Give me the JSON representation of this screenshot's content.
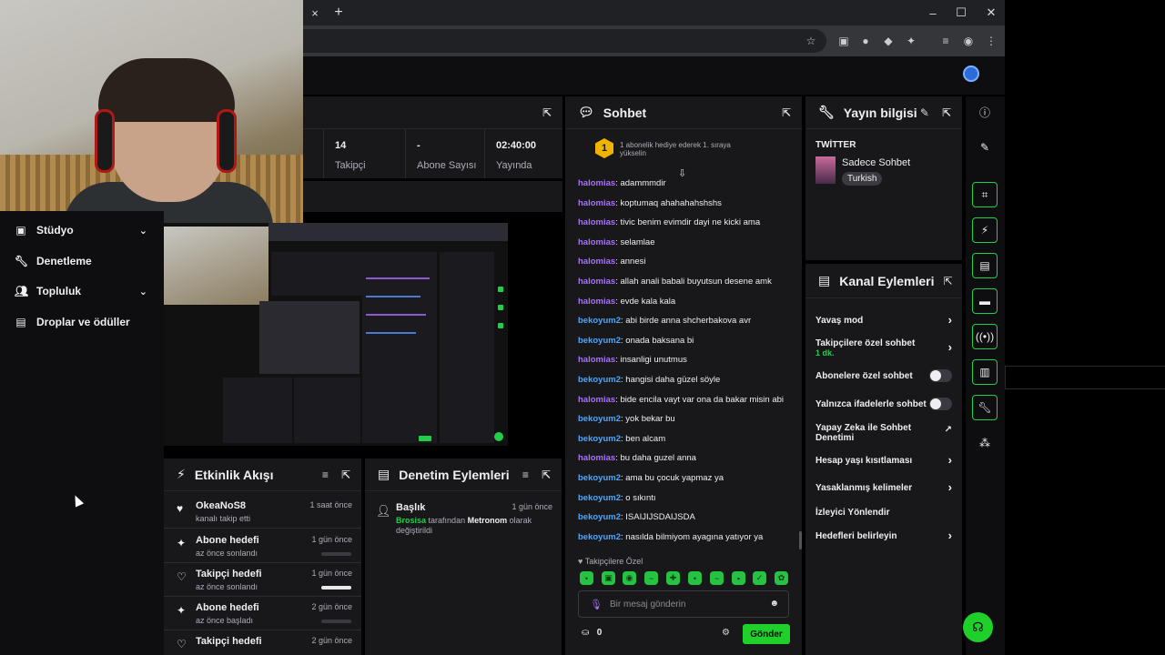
{
  "browser": {
    "tab_close": "×",
    "new_tab": "+",
    "window_controls": [
      "–",
      "☐",
      "✕"
    ]
  },
  "sidebar": {
    "items": [
      {
        "label": "Stüdyo",
        "icon": "studio-icon",
        "expandable": true
      },
      {
        "label": "Denetleme",
        "icon": "wrench-icon",
        "expandable": false
      },
      {
        "label": "Topluluk",
        "icon": "community-icon",
        "expandable": true
      },
      {
        "label": "Droplar ve ödüller",
        "icon": "drops-icon",
        "expandable": false
      }
    ]
  },
  "stats": [
    {
      "value": "14",
      "label": "Takipçi"
    },
    {
      "value": "-",
      "label": "Abone Sayısı"
    },
    {
      "value": "02:40:00",
      "label": "Yayında"
    }
  ],
  "activity_feed": {
    "title": "Etkinlik Akışı",
    "items": [
      {
        "icon": "heart-filled-icon",
        "title": "OkeaNoS8",
        "subtitle": "kanalı takip etti",
        "time": "1 saat önce",
        "progress": null
      },
      {
        "icon": "sparkle-icon",
        "title": "Abone hedefi",
        "subtitle": "az önce sonlandı",
        "time": "1 gün önce",
        "progress": 0
      },
      {
        "icon": "heart-outline-icon",
        "title": "Takipçi hedefi",
        "subtitle": "az önce sonlandı",
        "time": "1 gün önce",
        "progress": 1
      },
      {
        "icon": "sparkle-icon",
        "title": "Abone hedefi",
        "subtitle": "az önce başladı",
        "time": "2 gün önce",
        "progress": 0
      },
      {
        "icon": "heart-outline-icon",
        "title": "Takipçi hedefi",
        "subtitle": "",
        "time": "2 gün önce",
        "progress": null
      }
    ]
  },
  "moderation": {
    "title": "Denetim Eylemleri",
    "item": {
      "title": "Başlık",
      "actor": "Brosisa",
      "mid": "tarafından",
      "target": "Metronom",
      "end": "olarak değiştirildi",
      "time": "1 gün önce"
    }
  },
  "chat": {
    "title": "Sohbet",
    "hype_level": "1",
    "hype_text": "1 abonelik hediye ederek 1. sıraya yükselin",
    "messages": [
      {
        "user": "halomias",
        "text": "adammmdir"
      },
      {
        "user": "halomias",
        "text": "koptumaq ahahahahshshs"
      },
      {
        "user": "halomias",
        "text": "tivic benim evimdir dayi ne kicki ama"
      },
      {
        "user": "halomias",
        "text": "selamlae"
      },
      {
        "user": "halomias",
        "text": "annesi"
      },
      {
        "user": "halomias",
        "text": "allah anali babali buyutsun desene amk"
      },
      {
        "user": "halomias",
        "text": "evde kala kala"
      },
      {
        "user": "bekoyum2",
        "text": "abi birde anna shcherbakova avr"
      },
      {
        "user": "bekoyum2",
        "text": "onada baksana bi"
      },
      {
        "user": "halomias",
        "text": "insanligi unutmus"
      },
      {
        "user": "bekoyum2",
        "text": "hangisi daha güzel söyle"
      },
      {
        "user": "halomias",
        "text": "bide encila vayt var ona da bakar misin abi"
      },
      {
        "user": "bekoyum2",
        "text": "yok bekar bu"
      },
      {
        "user": "bekoyum2",
        "text": "ben alcam"
      },
      {
        "user": "halomias",
        "text": "bu daha guzel anna"
      },
      {
        "user": "bekoyum2",
        "text": "ama bu çocuk yapmaz ya"
      },
      {
        "user": "bekoyum2",
        "text": "o sıkıntı"
      },
      {
        "user": "bekoyum2",
        "text": "ISAIJIJSDAIJSDA"
      },
      {
        "user": "bekoyum2",
        "text": "nasılda bilmiyom ayagına yatıyor ya"
      }
    ],
    "emotes_label": "Takipçilere Özel",
    "input_placeholder": "Bir mesaj gönderin",
    "points": "0",
    "send_label": "Gönder"
  },
  "stream_info": {
    "title": "Yayın bilgisi",
    "category": "TWİTTER",
    "stream_title": "Sadece Sohbet",
    "tag": "Turkish"
  },
  "channel_actions": {
    "title": "Kanal Eylemleri",
    "items": [
      {
        "label": "Yavaş mod",
        "sub": "",
        "control": "chevron"
      },
      {
        "label": "Takipçilere özel sohbet",
        "sub": "1 dk.",
        "control": "chevron"
      },
      {
        "label": "Abonelere özel sohbet",
        "sub": "",
        "control": "toggle"
      },
      {
        "label": "Yalnızca ifadelerle sohbet",
        "sub": "",
        "control": "toggle"
      },
      {
        "label": "Yapay Zeka ile Sohbet Denetimi",
        "sub": "",
        "control": "external"
      },
      {
        "label": "Hesap yaşı kısıtlaması",
        "sub": "",
        "control": "chevron"
      },
      {
        "label": "Yasaklanmış kelimeler",
        "sub": "",
        "control": "chevron"
      },
      {
        "label": "İzleyici Yönlendir",
        "sub": "",
        "control": "none"
      },
      {
        "label": "Hedefleri belirleyin",
        "sub": "",
        "control": "chevron"
      }
    ]
  },
  "colors": {
    "accent": "#1fcf2a",
    "halomias": "#a970ff",
    "bekoyum2": "#4aa7ff",
    "panel": "#18181b"
  }
}
